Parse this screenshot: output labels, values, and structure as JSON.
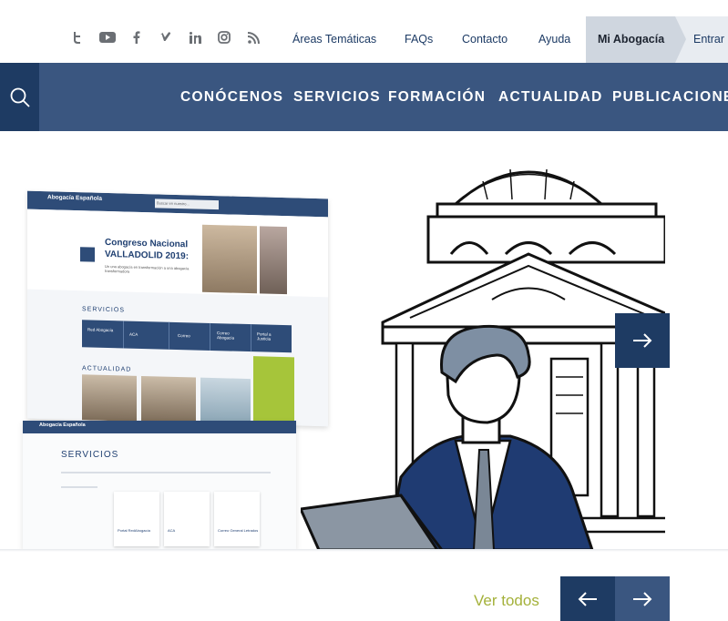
{
  "topbar": {
    "social_icons": [
      "twitter-icon",
      "youtube-icon",
      "facebook-icon",
      "vimeo-icon",
      "linkedin-icon",
      "instagram-icon",
      "rss-icon"
    ],
    "links": [
      "Áreas Temáticas",
      "FAQs",
      "Contacto",
      "Ayuda"
    ],
    "mi_abogacia": "Mi Abogacía",
    "entrar": "Entrar"
  },
  "nav": {
    "search_icon": "search-icon",
    "items": [
      "CONÓCENOS",
      "SERVICIOS",
      "FORMACIÓN",
      "ACTUALIDAD",
      "PUBLICACIONES"
    ]
  },
  "hero": {
    "mock1": {
      "logo": "Abogacía Española",
      "search_placeholder": "Buscar en nuestro...",
      "title_line1": "Congreso Nacional",
      "title_line2": "VALLADOLID 2019:",
      "subtitle": "Un una abogacía en transformación a una abogacía transformadora",
      "servicios": "SERVICIOS",
      "row_labels": [
        "Red Abogacía",
        "ACA",
        "Correo",
        "Correo Abogacía",
        "Portal a Justicia"
      ],
      "actualidad": "ACTUALIDAD"
    },
    "mock2": {
      "logo": "Abogacía Española",
      "servicios": "SERVICIOS",
      "cards": [
        "Portal RedAbogacía",
        "ACA",
        "Correo General Letrados"
      ]
    },
    "next_icon": "arrow-right-icon"
  },
  "footer_controls": {
    "ver_todos": "Ver todos",
    "prev_icon": "arrow-left-icon",
    "next_icon": "arrow-right-icon"
  },
  "colors": {
    "nav_bg": "#3a5680",
    "dark_blue": "#1e3b63",
    "accent_green": "#a4b13a",
    "mi_abogacia_bg": "#cfd6df"
  }
}
